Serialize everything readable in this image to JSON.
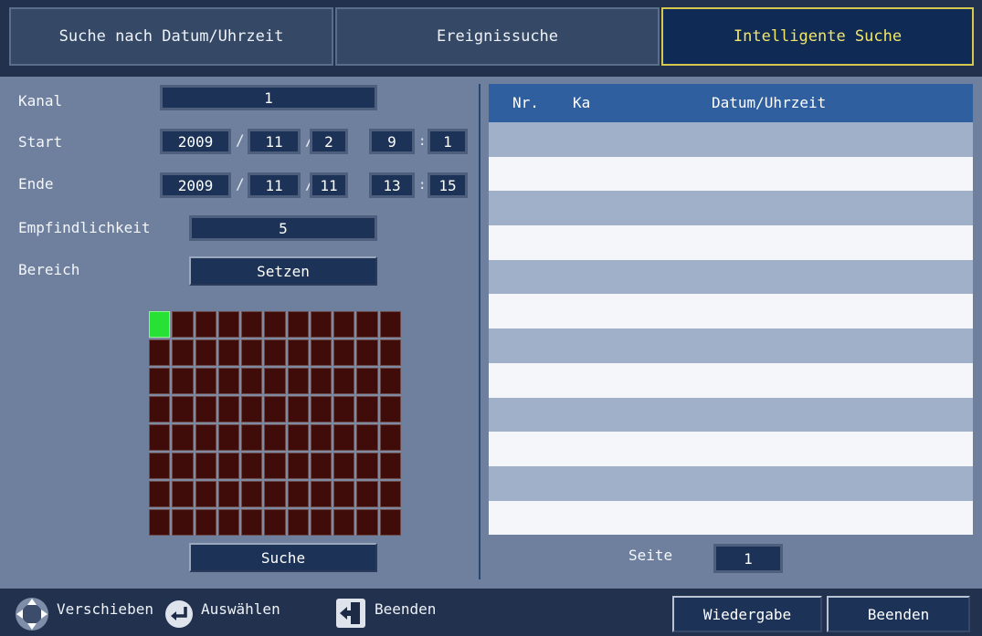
{
  "tabs": [
    {
      "label": "Suche nach Datum/Uhrzeit"
    },
    {
      "label": "Ereignissuche"
    },
    {
      "label": "Intelligente Suche"
    }
  ],
  "form": {
    "kanal_label": "Kanal",
    "kanal_value": "1",
    "start_label": "Start",
    "start": {
      "year": "2009",
      "month": "11",
      "day": "2",
      "hour": "9",
      "minute": "1"
    },
    "ende_label": "Ende",
    "ende": {
      "year": "2009",
      "month": "11",
      "day": "11",
      "hour": "13",
      "minute": "15"
    },
    "date_sep": "/",
    "time_sep": ":",
    "sensitivity_label": "Empfindlichkeit",
    "sensitivity_value": "5",
    "area_label": "Bereich",
    "area_button": "Setzen",
    "search_button": "Suche"
  },
  "grid": {
    "cols": 11,
    "rows": 8,
    "selected_cells": [
      [
        0,
        0
      ]
    ],
    "selected_color": "#27e234",
    "cell_color": "#3f0c0a"
  },
  "results": {
    "headers": {
      "nr": "Nr.",
      "ka": "Ka",
      "datetime": "Datum/Uhrzeit"
    },
    "rows": [],
    "page_label": "Seite",
    "page_value": "1"
  },
  "footer": {
    "move_label": "Verschieben",
    "select_label": "Auswählen",
    "exit_hint_label": "Beenden",
    "playback_button": "Wiedergabe",
    "exit_button": "Beenden"
  },
  "colors": {
    "active_tab_text": "#f2e66a",
    "active_tab_border": "#d8c84e",
    "header_bg": "#2f5f9e"
  }
}
